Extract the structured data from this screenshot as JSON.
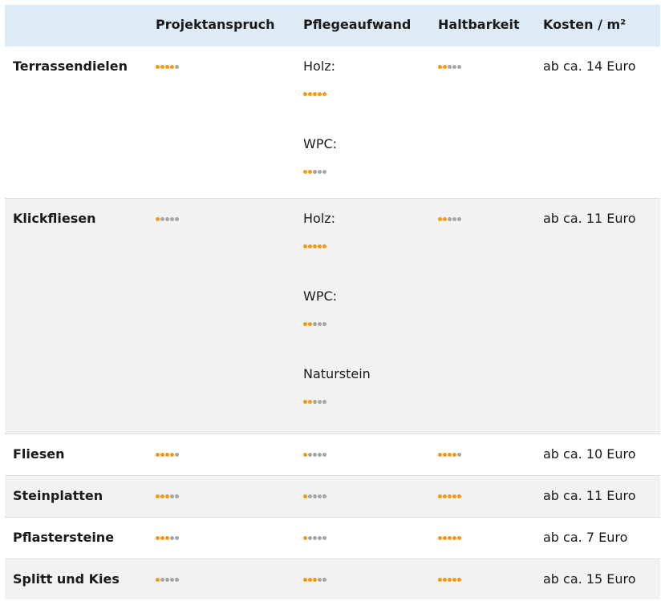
{
  "colors": {
    "accent": "#f39a12",
    "inactive": "#a6a6a6",
    "header_bg": "#dcebf5",
    "alt_row_bg": "#f2f2f2"
  },
  "headers": [
    "",
    "Projektanspruch",
    "Pflegeaufwand",
    "Haltbarkeit",
    "Kosten / m²"
  ],
  "rows": [
    {
      "name": "Terrassendielen",
      "projekt": 4,
      "pflege": [
        {
          "label": "Holz:",
          "rating": 5
        },
        {
          "label": "WPC:",
          "rating": 2
        }
      ],
      "haltbarkeit": 2,
      "kosten": "ab ca. 14 Euro"
    },
    {
      "name": "Klickfliesen",
      "projekt": 1,
      "pflege": [
        {
          "label": "Holz:",
          "rating": 5
        },
        {
          "label": "WPC:",
          "rating": 2
        },
        {
          "label": "Naturstein",
          "rating": 2
        }
      ],
      "haltbarkeit": 2,
      "kosten": "ab ca. 11 Euro"
    },
    {
      "name": "Fliesen",
      "projekt": 4,
      "pflege": [
        {
          "label": "",
          "rating": 1
        }
      ],
      "haltbarkeit": 4,
      "kosten": "ab ca. 10 Euro"
    },
    {
      "name": "Steinplatten",
      "projekt": 3,
      "pflege": [
        {
          "label": "",
          "rating": 1
        }
      ],
      "haltbarkeit": 5,
      "kosten": "ab ca. 11 Euro"
    },
    {
      "name": "Pflastersteine",
      "projekt": 3,
      "pflege": [
        {
          "label": "",
          "rating": 1
        }
      ],
      "haltbarkeit": 5,
      "kosten": "ab ca. 7 Euro"
    },
    {
      "name": "Splitt und Kies",
      "projekt": 1,
      "pflege": [
        {
          "label": "",
          "rating": 3
        }
      ],
      "haltbarkeit": 5,
      "kosten": "ab ca. 15 Euro"
    }
  ]
}
